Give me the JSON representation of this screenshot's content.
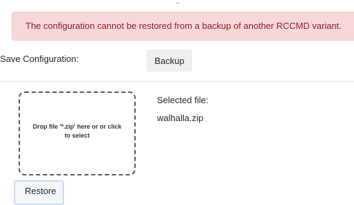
{
  "alert": {
    "message": "The configuration cannot be restored from a backup of another RCCMD variant."
  },
  "save": {
    "label": "Save Configuration:",
    "backup_button": "Backup"
  },
  "restore": {
    "dropzone_text": "Drop file '*.zip' here or or click to select",
    "selected_label": "Selected file:",
    "selected_file": "walhalla.zip",
    "restore_button": "Restore"
  },
  "colors": {
    "alert_bg": "#f8d7da",
    "alert_text": "#842029",
    "button_bg": "#f0f0f0",
    "focus_border": "#c9dcf2"
  }
}
